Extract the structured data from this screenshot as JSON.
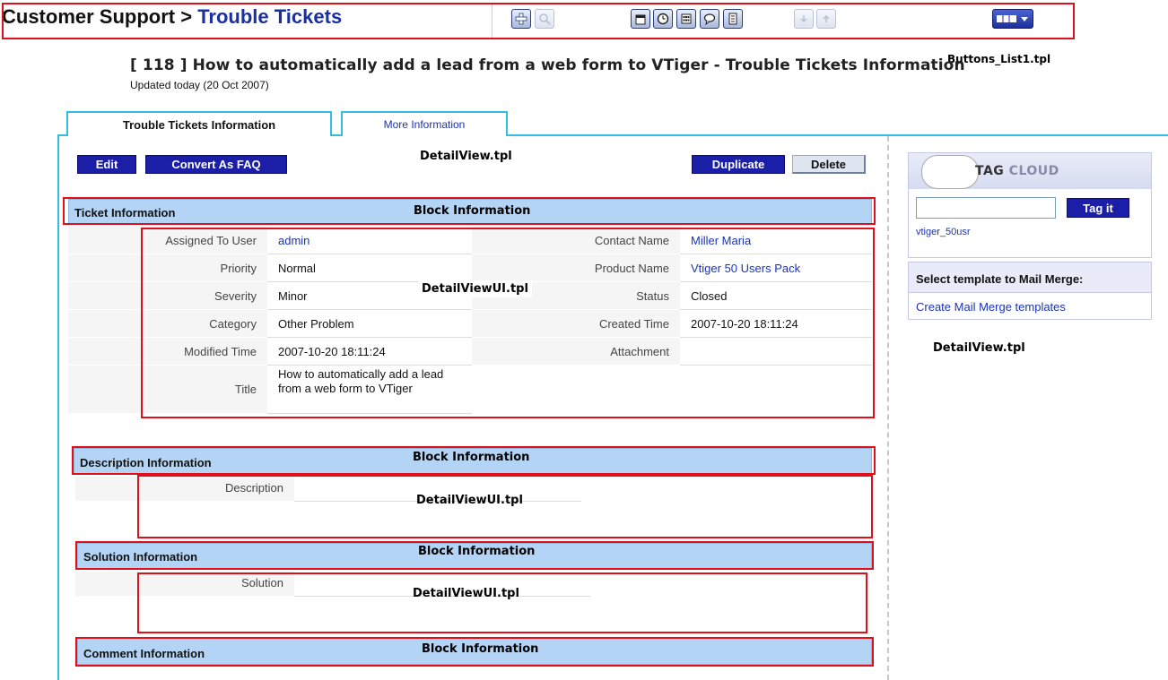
{
  "header": {
    "module": "Customer Support",
    "separator": " > ",
    "submodule": "Trouble Tickets",
    "annotation": "Buttons_List1.tpl",
    "icons": [
      {
        "name": "add-icon",
        "disabled": false
      },
      {
        "name": "search-icon",
        "disabled": true
      },
      {
        "name": "calendar-icon",
        "disabled": false
      },
      {
        "name": "clock-icon",
        "disabled": false
      },
      {
        "name": "calculator-icon",
        "disabled": false
      },
      {
        "name": "chat-icon",
        "disabled": false
      },
      {
        "name": "phone-list-icon",
        "disabled": false
      },
      {
        "name": "import-icon",
        "disabled": true
      },
      {
        "name": "export-icon",
        "disabled": true
      },
      {
        "name": "menu-dropdown-icon",
        "disabled": false
      }
    ]
  },
  "record": {
    "title": "[ 118 ] How to automatically add a lead from a web form to VTiger - Trouble Tickets Information",
    "updated": "Updated today (20 Oct 2007)"
  },
  "tabs": {
    "active": "Trouble Tickets Information",
    "inactive": "More Information"
  },
  "actions": {
    "edit": "Edit",
    "convert_faq": "Convert As FAQ",
    "duplicate": "Duplicate",
    "delete": "Delete"
  },
  "annotations": {
    "detail_view": "DetailView.tpl",
    "block_info": "Block Information",
    "detail_view_ui": "DetailViewUI.tpl"
  },
  "blocks": {
    "ticket": "Ticket Information",
    "description": "Description Information",
    "solution": "Solution Information",
    "comment": "Comment Information"
  },
  "fields": {
    "assigned_to_label": "Assigned To User",
    "assigned_to_value": "admin",
    "contact_label": "Contact Name",
    "contact_value": "Miller Maria",
    "priority_label": "Priority",
    "priority_value": "Normal",
    "product_label": "Product Name",
    "product_value": "Vtiger 50 Users Pack",
    "severity_label": "Severity",
    "severity_value": "Minor",
    "status_label": "Status",
    "status_value": "Closed",
    "category_label": "Category",
    "category_value": "Other Problem",
    "created_label": "Created Time",
    "created_value": "2007-10-20 18:11:24",
    "modified_label": "Modified Time",
    "modified_value": "2007-10-20 18:11:24",
    "attachment_label": "Attachment",
    "title_label": "Title",
    "title_value": "How to automatically add a lead from a web form to VTiger",
    "description_label": "Description",
    "solution_label": "Solution"
  },
  "sidebar": {
    "tag_cloud_word1": "TAG",
    "tag_cloud_word2": "CLOUD",
    "tag_button": "Tag it",
    "tag_item": "vtiger_50usr",
    "mail_merge_title": "Select template to Mail Merge:",
    "mail_merge_link": "Create Mail Merge templates"
  },
  "colors": {
    "annotation_border": "#e0101a",
    "tab_border": "#33bde0",
    "block_header": "#b3d4f5",
    "button_blue": "#1b1fa8",
    "link": "#1a33b8"
  }
}
